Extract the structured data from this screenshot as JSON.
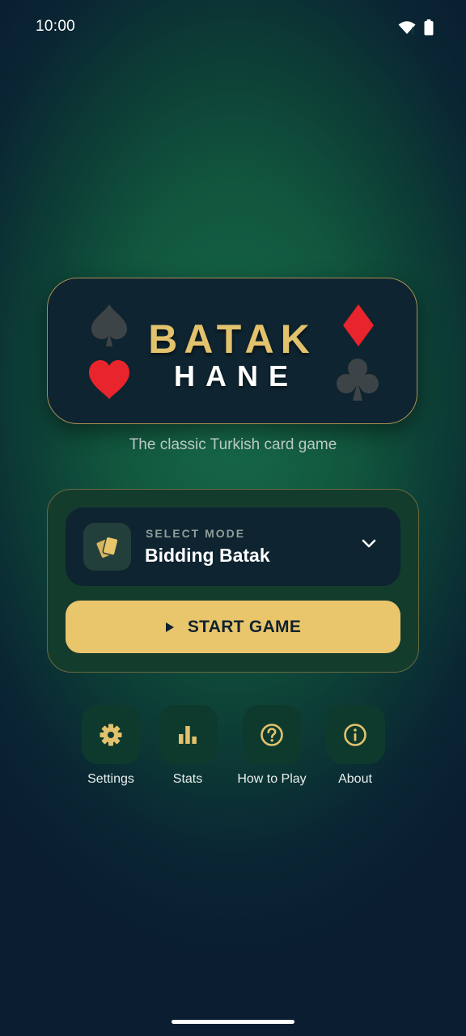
{
  "status_bar": {
    "time": "10:00"
  },
  "logo": {
    "line1": "BATAK",
    "line2": "HANE"
  },
  "tagline": "The classic Turkish card game",
  "mode": {
    "label": "SELECT MODE",
    "value": "Bidding Batak"
  },
  "start_button": {
    "label": "START GAME"
  },
  "menu": [
    {
      "label": "Settings",
      "icon": "gear-icon"
    },
    {
      "label": "Stats",
      "icon": "bar-chart-icon"
    },
    {
      "label": "How to Play",
      "icon": "help-icon"
    },
    {
      "label": "About",
      "icon": "info-icon"
    }
  ],
  "colors": {
    "accent": "#e9c66c",
    "card": "#0e2430",
    "red_suit": "#e8242c",
    "dark_suit": "#3d4447"
  }
}
